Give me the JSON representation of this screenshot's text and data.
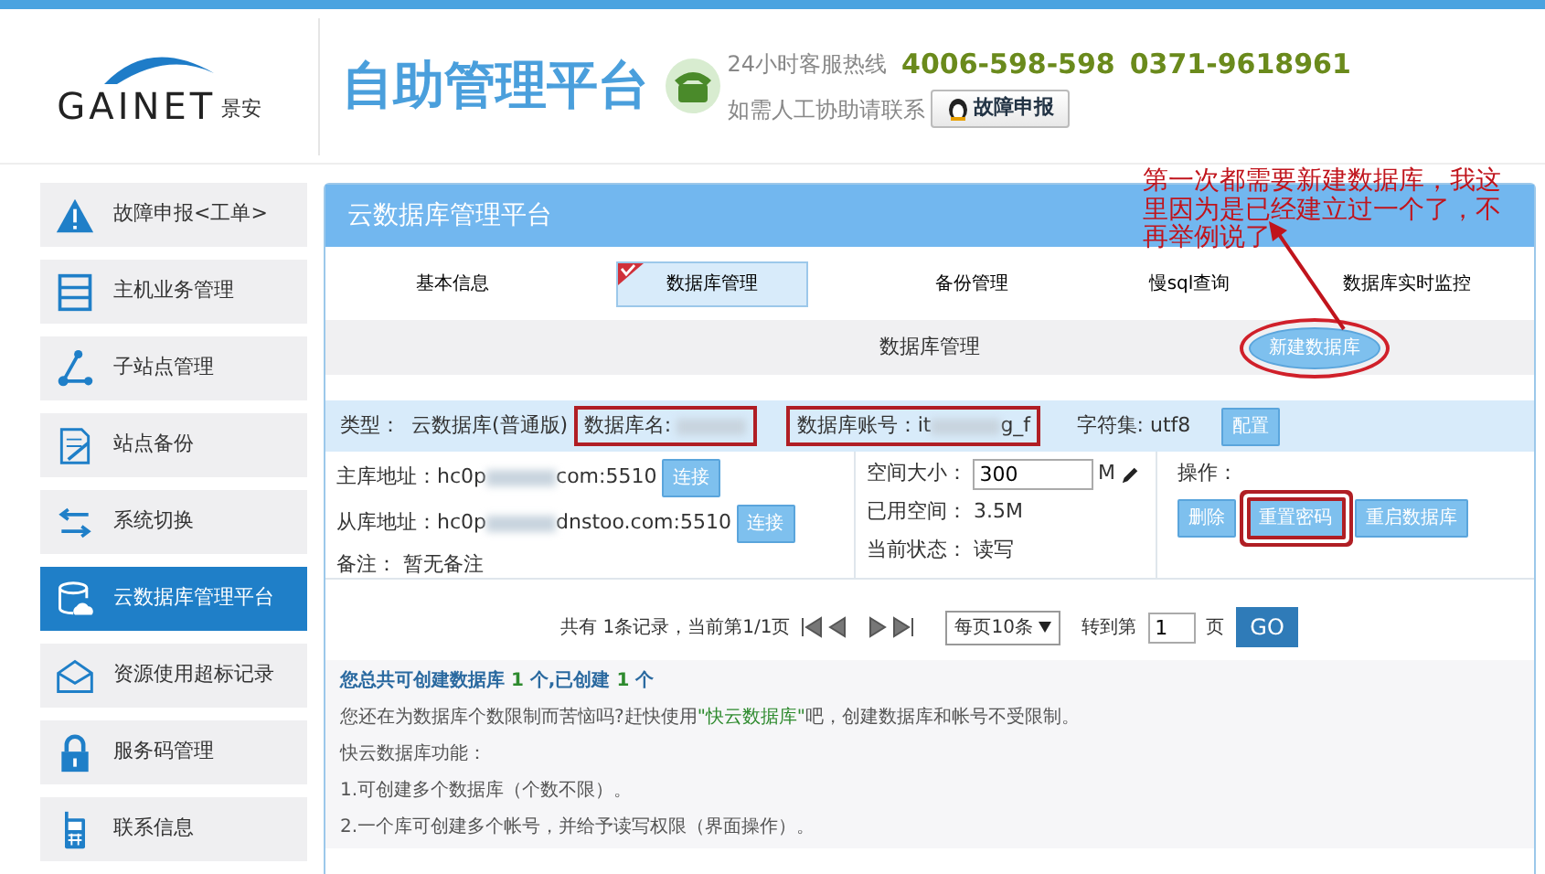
{
  "header": {
    "logo_text": "GAINET",
    "logo_cn": "景安",
    "title": "自助管理平台",
    "hotline_label": "24小时客服热线",
    "phones": [
      "4006-598-598",
      "0371-9618961"
    ],
    "help_label": "如需人工协助请联系",
    "help_button": "故障申报"
  },
  "sidebar": {
    "items": [
      {
        "label": "故障申报<工单>",
        "selected": false
      },
      {
        "label": "主机业务管理",
        "selected": false
      },
      {
        "label": "子站点管理",
        "selected": false
      },
      {
        "label": "站点备份",
        "selected": false
      },
      {
        "label": "系统切换",
        "selected": false
      },
      {
        "label": "云数据库管理平台",
        "selected": true
      },
      {
        "label": "资源使用超标记录",
        "selected": false
      },
      {
        "label": "服务码管理",
        "selected": false
      },
      {
        "label": "联系信息",
        "selected": false
      }
    ]
  },
  "panel": {
    "title": "云数据库管理平台",
    "tabs": [
      {
        "label": "基本信息",
        "selected": false
      },
      {
        "label": "数据库管理",
        "selected": true
      },
      {
        "label": "备份管理",
        "selected": false
      },
      {
        "label": "慢sql查询",
        "selected": false
      },
      {
        "label": "数据库实时监控",
        "selected": false
      }
    ],
    "subbar": {
      "label": "数据库管理",
      "button": "新建数据库",
      "highlighted": true
    },
    "info": {
      "type_label": "类型：",
      "type_value": "云数据库(普通版)",
      "name_label": "数据库名:",
      "name_highlighted": true,
      "account_label": "数据库账号：",
      "account_start": "it",
      "account_end": "g_f",
      "account_highlighted": true,
      "charset": "字符集: utf8",
      "config_button": "配置"
    },
    "details": {
      "master": {
        "label": "主库地址：",
        "start": "hc0p",
        "end": "com:5510",
        "button": "连接"
      },
      "slave": {
        "label": "从库地址：",
        "start": "hc0p",
        "end": "dnstoo.com:5510",
        "button": "连接"
      },
      "note": "备注： 暂无备注",
      "space_label": "空间大小：",
      "space_value": "300",
      "space_unit": "M",
      "used": "已用空间： 3.5M",
      "status": "当前状态： 读写",
      "ops_label": "操作：",
      "ops_buttons": [
        {
          "label": "删除",
          "highlighted": false
        },
        {
          "label": "重置密码",
          "highlighted": true
        },
        {
          "label": "重启数据库",
          "highlighted": false
        }
      ]
    },
    "pagination": {
      "summary": "共有 1条记录，当前第1/1页",
      "per_page": "每页10条",
      "goto_label": "转到第",
      "page_value": "1",
      "page_unit": "页",
      "go": "GO"
    },
    "notes": {
      "quota": "您总共可创建数据库 **1** 个,已创建 **1** 个",
      "promo_start": "您还在为数据库个数限制而苦恼吗?赶快使用",
      "promo_link": "\"快云数据库\"",
      "promo_end": "吧，创建数据库和帐号不受限制。",
      "features_title": "快云数据库功能：",
      "features": [
        "1.可创建多个数据库（个数不限）。",
        "2.一个库可创建多个帐号，并给予读写权限（界面操作）。"
      ]
    }
  },
  "annotation": {
    "text": "第一次都需要新建数据库，我这里因为是已经建立过一个了，不再举例说了"
  }
}
